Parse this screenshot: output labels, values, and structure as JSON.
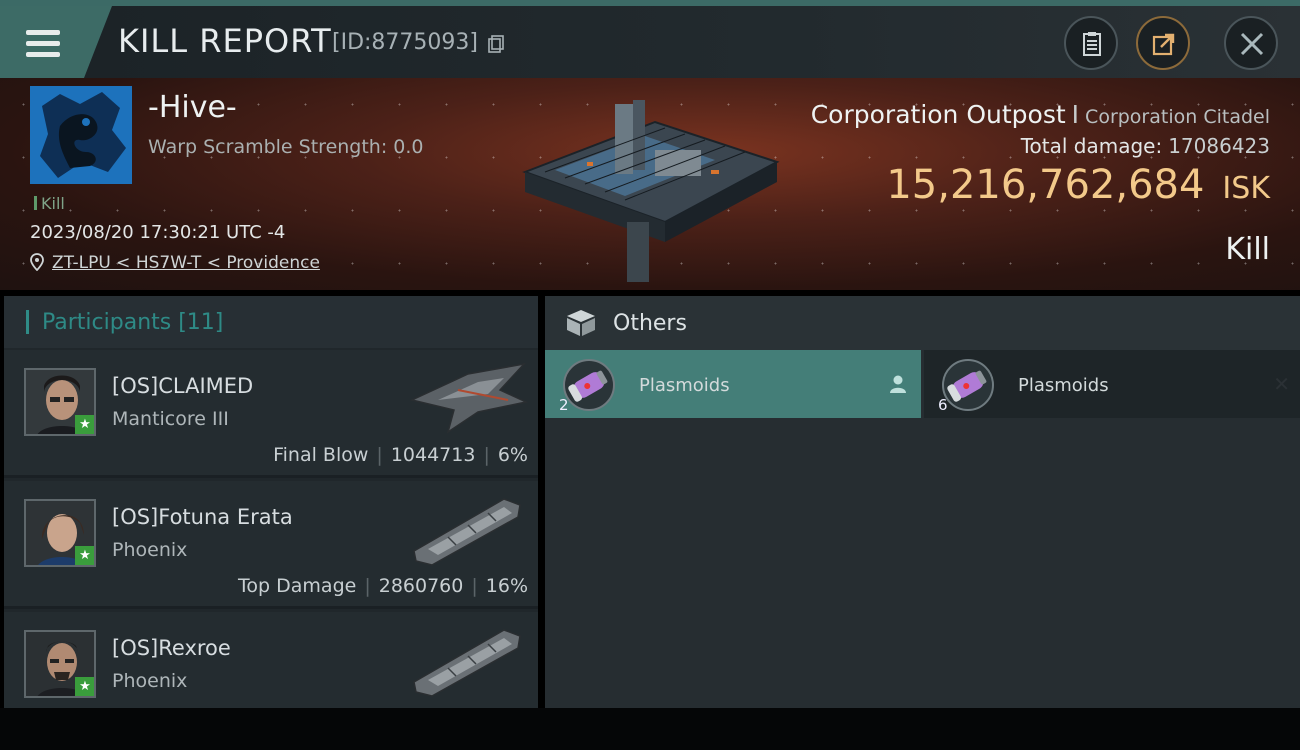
{
  "header": {
    "title": "KILL REPORT",
    "report_id": "[ID:8775093]",
    "buttons": [
      "clipboard-icon",
      "export-icon",
      "close-icon"
    ]
  },
  "victim": {
    "name": "-Hive-",
    "warp_scramble": "Warp Scramble Strength: 0.0",
    "tag": "Kill",
    "timestamp": "2023/08/20 17:30:21 UTC -4",
    "location": "ZT-LPU < HS7W-T < Providence",
    "ship_type": "Corporation Outpost",
    "separator": "I",
    "ship_class": "Corporation Citadel",
    "total_damage_label": "Total damage:",
    "total_damage": "17086423",
    "isk_value": "15,216,762,684",
    "isk_unit": "ISK",
    "result": "Kill"
  },
  "participants": {
    "header": "Participants [11]",
    "rows": [
      {
        "name": "[OS]CLAIMED",
        "ship": "Manticore III",
        "role": "Final Blow",
        "damage": "1044713",
        "percent": "6%"
      },
      {
        "name": "[OS]Fotuna Erata",
        "ship": "Phoenix",
        "role": "Top Damage",
        "damage": "2860760",
        "percent": "16%"
      },
      {
        "name": "[OS]Rexroe",
        "ship": "Phoenix",
        "role": "",
        "damage": "",
        "percent": ""
      }
    ]
  },
  "others": {
    "header": "Others",
    "items": [
      {
        "name": "Plasmoids",
        "qty": "2",
        "selected": true
      },
      {
        "name": "Plasmoids",
        "qty": "6",
        "selected": false
      }
    ]
  },
  "colors": {
    "accent": "#2f8c87",
    "isk": "#f3c98a",
    "selected_item": "#447e78"
  }
}
